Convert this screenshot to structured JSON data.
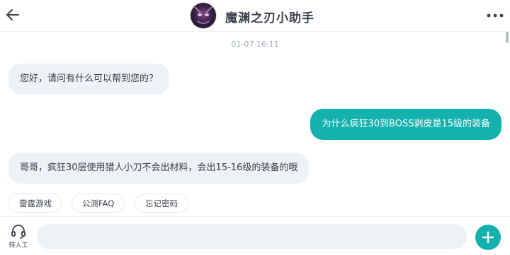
{
  "header": {
    "title": "魔渊之刃小助手",
    "back_icon": "arrow-left-icon",
    "more_icon": "more-horizontal-icon"
  },
  "chat": {
    "timestamp": "01-07 16:11",
    "messages": [
      {
        "role": "bot",
        "text": "您好，请问有什么可以帮到您的？"
      },
      {
        "role": "user",
        "text": "为什么疯狂30到BOSS剥皮是15级的装备"
      },
      {
        "role": "bot",
        "text": "哥哥，疯狂30层使用猎人小刀不会出材料，会出15-16级的装备的哦"
      }
    ]
  },
  "quick_replies": [
    "雷霆游戏",
    "公测FAQ",
    "忘记密码"
  ],
  "bottom": {
    "agent_label": "转人工",
    "agent_icon": "headset-icon",
    "input_value": "",
    "plus_icon": "plus-icon"
  },
  "colors": {
    "accent": "#15b1ac",
    "bot_bubble": "#eef1f6",
    "text": "#3b404b"
  }
}
